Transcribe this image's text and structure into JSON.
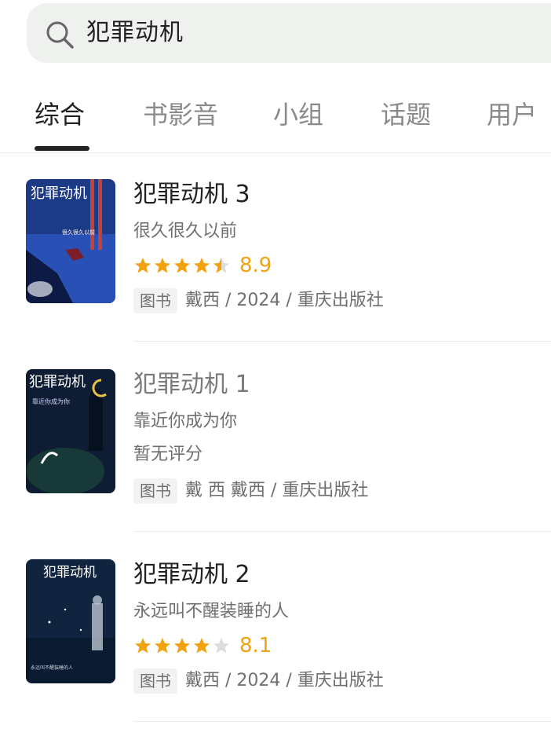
{
  "search": {
    "query": "犯罪动机"
  },
  "tabs": [
    {
      "label": "综合",
      "active": true
    },
    {
      "label": "书影音",
      "active": false
    },
    {
      "label": "小组",
      "active": false
    },
    {
      "label": "话题",
      "active": false
    },
    {
      "label": "用户",
      "active": false
    }
  ],
  "results": [
    {
      "title": "犯罪动机 3",
      "subtitle": "很久很久以前",
      "rating_stars": 4.5,
      "score": "8.9",
      "no_rating_text": "",
      "type_tag": "图书",
      "meta": "戴西 / 2024 / 重庆出版社",
      "cover": {
        "title": "犯罪动机",
        "tagline": "很久很久以前",
        "accent": "#1f3b7a"
      }
    },
    {
      "title": "犯罪动机 1",
      "subtitle": "靠近你成为你",
      "rating_stars": 0,
      "score": "",
      "no_rating_text": "暂无评分",
      "type_tag": "图书",
      "meta": "戴 西 戴西 / 重庆出版社",
      "cover": {
        "title": "犯罪动机",
        "tagline": "靠近你成为你",
        "accent": "#0e1d33"
      }
    },
    {
      "title": "犯罪动机 2",
      "subtitle": "永远叫不醒装睡的人",
      "rating_stars": 4,
      "score": "8.1",
      "no_rating_text": "",
      "type_tag": "图书",
      "meta": "戴西 / 2024 / 重庆出版社",
      "cover": {
        "title": "犯罪动机",
        "tagline": "永远叫不醒装睡的人",
        "accent": "#10243f"
      }
    }
  ],
  "colors": {
    "star": "#f2a20f",
    "star_empty": "#dddddd",
    "search_bg": "#eef1ee"
  }
}
